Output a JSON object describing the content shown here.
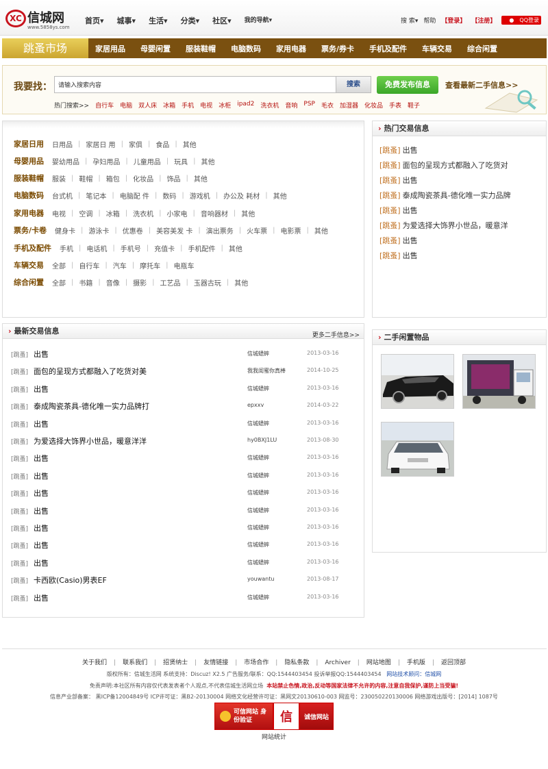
{
  "header": {
    "logo_name": "信城网",
    "logo_url": "www.5858ys.com",
    "logo_mark": "XC",
    "nav": [
      "首页▾",
      "城事▾",
      "生活▾",
      "分类▾",
      "社区▾",
      "我的导航▾"
    ],
    "search": "搜 索▾",
    "help": "帮助",
    "login": "【登录】",
    "register": "【注册】",
    "qq": "QQ登录"
  },
  "market": {
    "title": "跳蚤市场",
    "categories": [
      "家居用品",
      "母婴闲置",
      "服装鞋帽",
      "电脑数码",
      "家用电器",
      "票务/券卡",
      "手机及配件",
      "车辆交易",
      "综合闲置"
    ]
  },
  "search": {
    "label": "我要找：",
    "placeholder": "请输入搜索内容",
    "button": "搜索",
    "publish": "免费发布信息",
    "latest_link": "查看最新二手信息>>",
    "hot_label": "热门搜索>>",
    "hot_keywords": [
      "自行车",
      "电脑",
      "双人床",
      "冰箱",
      "手机",
      "电视",
      "冰柜",
      "ipad2",
      "洗衣机",
      "音响",
      "PSP",
      "毛衣",
      "加湿器",
      "化妆品",
      "手表",
      "鞋子"
    ]
  },
  "categories": [
    {
      "name": "家居日用",
      "subs": [
        "日用品",
        "家居日 用",
        "家俱",
        "食品",
        "其他"
      ]
    },
    {
      "name": "母婴用品",
      "subs": [
        "婴幼用品",
        "孕妇用品",
        "儿童用品",
        "玩具",
        "其他"
      ]
    },
    {
      "name": "服装鞋帽",
      "subs": [
        "服装",
        "鞋帽",
        "箱包",
        "化妆品",
        "饰品",
        "其他"
      ]
    },
    {
      "name": "电脑数码",
      "subs": [
        "台式机",
        "笔记本",
        "电脑配 件",
        "数码",
        "游戏机",
        "办公及 耗材",
        "其他"
      ]
    },
    {
      "name": "家用电器",
      "subs": [
        "电视",
        "空调",
        "冰箱",
        "洗衣机",
        "小家电",
        "音响器材",
        "其他"
      ]
    },
    {
      "name": "票务/卡卷",
      "subs": [
        "健身卡",
        "游泳卡",
        "优惠卷",
        "美容美发 卡",
        "演出票务",
        "火车票",
        "电影票",
        "其他"
      ]
    },
    {
      "name": "手机及配件",
      "subs": [
        "手机",
        "电话机",
        "手机号",
        "充值卡",
        "手机配件",
        "其他"
      ]
    },
    {
      "name": "车辆交易",
      "subs": [
        "全部",
        "自行车",
        "汽车",
        "摩托车",
        "电瓶车"
      ]
    },
    {
      "name": "综合闲置",
      "subs": [
        "全部",
        "书籍",
        "音像",
        "摄影",
        "工艺品",
        "玉器古玩",
        "其他"
      ]
    }
  ],
  "hot_trades": {
    "title": "热门交易信息",
    "items": [
      {
        "tag": "[跳蚤]",
        "title": "出售"
      },
      {
        "tag": "[跳蚤]",
        "title": "面包的呈现方式都融入了吃货对"
      },
      {
        "tag": "[跳蚤]",
        "title": "出售"
      },
      {
        "tag": "[跳蚤]",
        "title": "泰成陶瓷茶具-德化唯一实力品牌"
      },
      {
        "tag": "[跳蚤]",
        "title": "出售"
      },
      {
        "tag": "[跳蚤]",
        "title": "为爱选择大饰界小世品，暖意洋"
      },
      {
        "tag": "[跳蚤]",
        "title": "出售"
      },
      {
        "tag": "[跳蚤]",
        "title": "出售"
      }
    ]
  },
  "second_hand": {
    "title": "二手闲置物品"
  },
  "latest": {
    "title": "最新交易信息",
    "more": "更多二手信息>>",
    "rows": [
      {
        "cat": "[跳蚤]",
        "title": "出售",
        "user": "信城蟋蟀",
        "date": "2013-03-16"
      },
      {
        "cat": "[跳蚤]",
        "title": "面包的呈现方式都融入了吃货对美",
        "user": "我我闺蜜你真棒",
        "date": "2014-10-25"
      },
      {
        "cat": "[跳蚤]",
        "title": "出售",
        "user": "信城蟋蟀",
        "date": "2013-03-16"
      },
      {
        "cat": "[跳蚤]",
        "title": "泰成陶瓷茶具-德化唯一实力品牌打",
        "user": "epxxv",
        "date": "2014-03-22"
      },
      {
        "cat": "[跳蚤]",
        "title": "出售",
        "user": "信城蟋蟀",
        "date": "2013-03-16"
      },
      {
        "cat": "[跳蚤]",
        "title": "为爱选择大饰界小世品，暖意洋洋",
        "user": "hy0BXJ1LU",
        "date": "2013-08-30"
      },
      {
        "cat": "[跳蚤]",
        "title": "出售",
        "user": "信城蟋蟀",
        "date": "2013-03-16"
      },
      {
        "cat": "[跳蚤]",
        "title": "出售",
        "user": "信城蟋蟀",
        "date": "2013-03-16"
      },
      {
        "cat": "[跳蚤]",
        "title": "出售",
        "user": "信城蟋蟀",
        "date": "2013-03-16"
      },
      {
        "cat": "[跳蚤]",
        "title": "出售",
        "user": "信城蟋蟀",
        "date": "2013-03-16"
      },
      {
        "cat": "[跳蚤]",
        "title": "出售",
        "user": "信城蟋蟀",
        "date": "2013-03-16"
      },
      {
        "cat": "[跳蚤]",
        "title": "出售",
        "user": "信城蟋蟀",
        "date": "2013-03-16"
      },
      {
        "cat": "[跳蚤]",
        "title": "出售",
        "user": "信城蟋蟀",
        "date": "2013-03-16"
      },
      {
        "cat": "[跳蚤]",
        "title": "卡西欧(Casio)男表EF",
        "user": "youwantu",
        "date": "2013-08-17"
      },
      {
        "cat": "[跳蚤]",
        "title": "出售",
        "user": "信城蟋蟀",
        "date": "2013-03-16"
      }
    ]
  },
  "footer": {
    "links": [
      "关于我们",
      "联系我们",
      "招贤纳士",
      "友情链接",
      "市场合作",
      "隐私条款",
      "Archiver",
      "网站地图",
      "手机版",
      "返回顶部"
    ],
    "copyright": "版权所有：信城生活网  系统支持：Discuz! X2.5    广告服务/联系：QQ:1544403454   投诉举报QQ:1544403454",
    "tech": "网站技术顾问：信城网",
    "disclaimer": "免责声明:本社区所有内容仅代表发表者个人观点,不代表信城生活网立场",
    "disclaimer_red": "本站禁止色情,政治,反动等国家法律不允许的内容,注意自我保护,谨防上当受骗!",
    "license": "信息产业部备案：  黑ICP备12004849号  ICP许可证：黑B2-20130004  网络文化经营许可证：黑网文20130610-003  网监号：230050220130006  网络游戏出版号：[2014] 1087号",
    "badge1": "可信网站 身份验证",
    "badge2": "信",
    "badge3": "诚信网站",
    "stats": "网站统计"
  },
  "colors": {
    "brand_red": "#c8141e",
    "market_brown": "#7a5010",
    "market_gold": "#d4b13f",
    "publish_green": "#49b32f"
  }
}
